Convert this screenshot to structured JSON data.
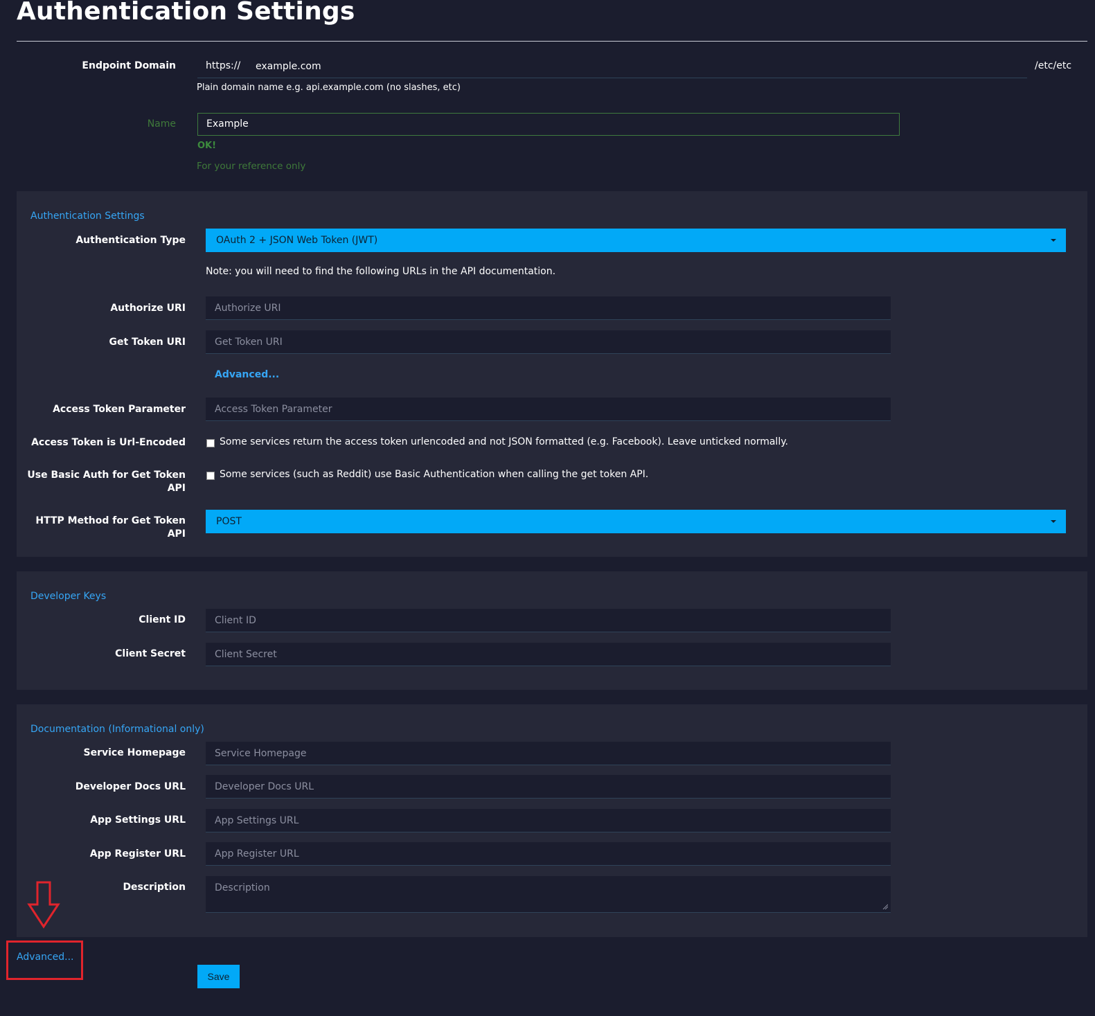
{
  "page": {
    "title": "Authentication Settings"
  },
  "endpoint": {
    "label": "Endpoint Domain",
    "prefix": "https://",
    "value": "example.com",
    "suffix": "/etc/etc",
    "help": "Plain domain name e.g. api.example.com (no slashes, etc)"
  },
  "name_field": {
    "label": "Name",
    "value": "Example",
    "status": "OK!",
    "help": "For your reference only"
  },
  "auth_panel": {
    "heading": "Authentication Settings",
    "auth_type_label": "Authentication Type",
    "auth_type_value": "OAuth 2 + JSON Web Token (JWT)",
    "note": "Note: you will need to find the following URLs in the API documentation.",
    "authorize_uri_label": "Authorize URI",
    "authorize_uri_placeholder": "Authorize URI",
    "get_token_uri_label": "Get Token URI",
    "get_token_uri_placeholder": "Get Token URI",
    "advanced_link": "Advanced...",
    "access_token_param_label": "Access Token Parameter",
    "access_token_param_placeholder": "Access Token Parameter",
    "url_encoded_label": "Access Token is Url-Encoded",
    "url_encoded_text": "Some services return the access token urlencoded and not JSON formatted (e.g. Facebook). Leave unticked normally.",
    "basic_auth_label": "Use Basic Auth for Get Token API",
    "basic_auth_text": "Some services (such as Reddit) use Basic Authentication when calling the get token API.",
    "http_method_label": "HTTP Method for Get Token API",
    "http_method_value": "POST"
  },
  "keys_panel": {
    "heading": "Developer Keys",
    "client_id_label": "Client ID",
    "client_id_placeholder": "Client ID",
    "client_secret_label": "Client Secret",
    "client_secret_placeholder": "Client Secret"
  },
  "docs_panel": {
    "heading": "Documentation (Informational only)",
    "homepage_label": "Service Homepage",
    "homepage_placeholder": "Service Homepage",
    "dev_docs_label": "Developer Docs URL",
    "dev_docs_placeholder": "Developer Docs URL",
    "app_settings_label": "App Settings URL",
    "app_settings_placeholder": "App Settings URL",
    "app_register_label": "App Register URL",
    "app_register_placeholder": "App Register URL",
    "description_label": "Description",
    "description_placeholder": "Description"
  },
  "footer": {
    "advanced_link": "Advanced...",
    "save_label": "Save"
  },
  "colors": {
    "background": "#1b1d2e",
    "panel": "#262838",
    "accent": "#02a9f7",
    "link": "#36a6f5",
    "ok_green": "#3d8b3d",
    "annotation_red": "#e0242c"
  },
  "icons": {
    "dropdown": "caret-down-icon",
    "annotation_arrow": "arrow-down-icon"
  }
}
